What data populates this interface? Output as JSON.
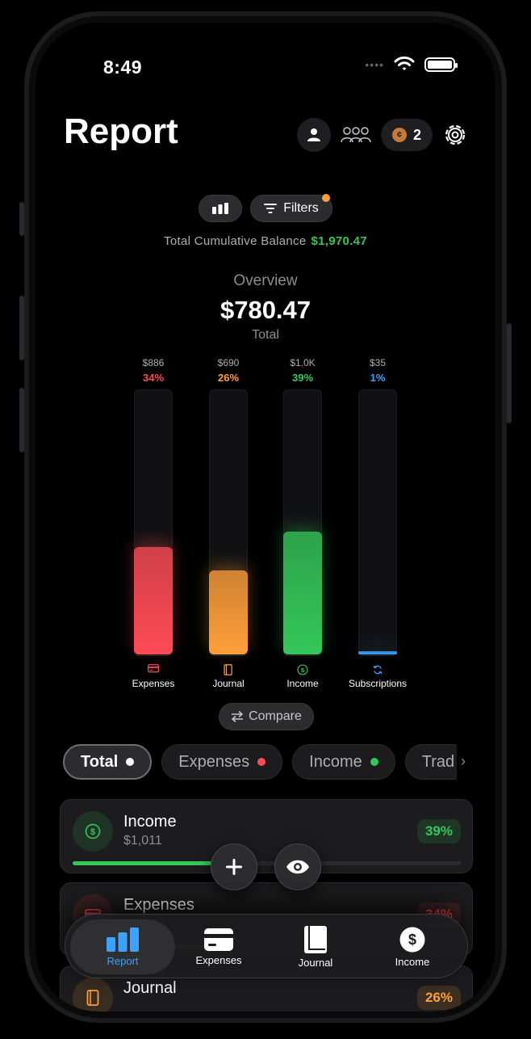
{
  "status_bar": {
    "time": "8:49"
  },
  "header": {
    "title": "Report",
    "coin_count": "2"
  },
  "toolbar": {
    "filters_label": "Filters"
  },
  "summary": {
    "cumulative_label": "Total Cumulative Balance",
    "cumulative_value": "$1,970.47",
    "overview_label": "Overview",
    "overview_amount": "$780.47",
    "overview_sub": "Total"
  },
  "chart_data": {
    "type": "bar",
    "categories": [
      "Expenses",
      "Journal",
      "Income",
      "Subscriptions"
    ],
    "values": [
      886,
      690,
      1011,
      35
    ],
    "value_labels": [
      "$886",
      "$690",
      "$1.0K",
      "$35"
    ],
    "percent_labels": [
      "34%",
      "26%",
      "39%",
      "1%"
    ],
    "percents": [
      34,
      26,
      39,
      1
    ],
    "colors": [
      "#ff4b55",
      "#ff9f3a",
      "#34c759",
      "#3ba2ff"
    ],
    "icons": [
      "card-icon",
      "book-icon",
      "dollar-circle-icon",
      "refresh-icon"
    ]
  },
  "compare": {
    "label": "Compare"
  },
  "tabs": [
    {
      "label": "Total",
      "dot": "#ffffff"
    },
    {
      "label": "Expenses",
      "dot": "#ff4b55"
    },
    {
      "label": "Income",
      "dot": "#34c759"
    },
    {
      "label": "Trad",
      "dot": ""
    }
  ],
  "rows": [
    {
      "title": "Income",
      "value": "$1,011",
      "pct": "39%",
      "progress": 0.39,
      "color": "#34c759"
    },
    {
      "title": "Expenses",
      "value": "",
      "pct": "34%",
      "progress": 0.34,
      "color": "#ff4b55"
    },
    {
      "title": "Journal",
      "value": "",
      "pct": "26%",
      "progress": 0.26,
      "color": "#ff9f3a"
    }
  ],
  "nav": [
    {
      "label": "Report",
      "icon": "bar-chart-icon",
      "active": true
    },
    {
      "label": "Expenses",
      "icon": "card-icon",
      "active": false
    },
    {
      "label": "Journal",
      "icon": "book-icon",
      "active": false
    },
    {
      "label": "Income",
      "icon": "dollar-circle-icon",
      "active": false
    }
  ]
}
